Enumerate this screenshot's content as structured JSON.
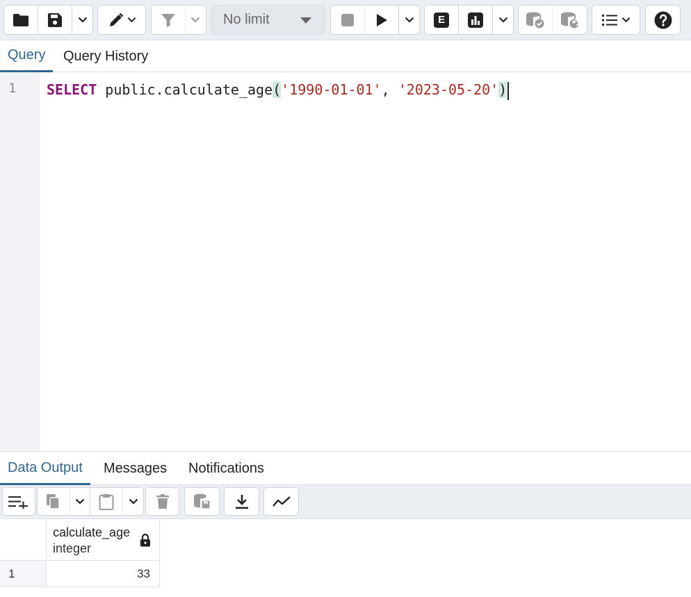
{
  "toolbar": {
    "limit_value": "No limit",
    "explain_letter": "E"
  },
  "query_tabs": [
    {
      "label": "Query",
      "active": true
    },
    {
      "label": "Query History",
      "active": false
    }
  ],
  "editor": {
    "line_number": "1",
    "tokens": {
      "keyword": "SELECT",
      "function": " public.calculate_age",
      "open_paren": "(",
      "arg1": "'1990-01-01'",
      "comma": ", ",
      "arg2": "'2023-05-20'",
      "close_paren": ")"
    }
  },
  "output_tabs": [
    {
      "label": "Data Output",
      "active": true
    },
    {
      "label": "Messages",
      "active": false
    },
    {
      "label": "Notifications",
      "active": false
    }
  ],
  "result": {
    "columns": [
      {
        "name": "calculate_age",
        "type": "integer",
        "locked": true
      }
    ],
    "rows": [
      {
        "row_number": "1",
        "values": [
          "33"
        ]
      }
    ]
  },
  "colors": {
    "accent": "#326690",
    "keyword": "#8a1474",
    "string": "#a8291f",
    "toolbar_bg": "#ebeef3"
  }
}
